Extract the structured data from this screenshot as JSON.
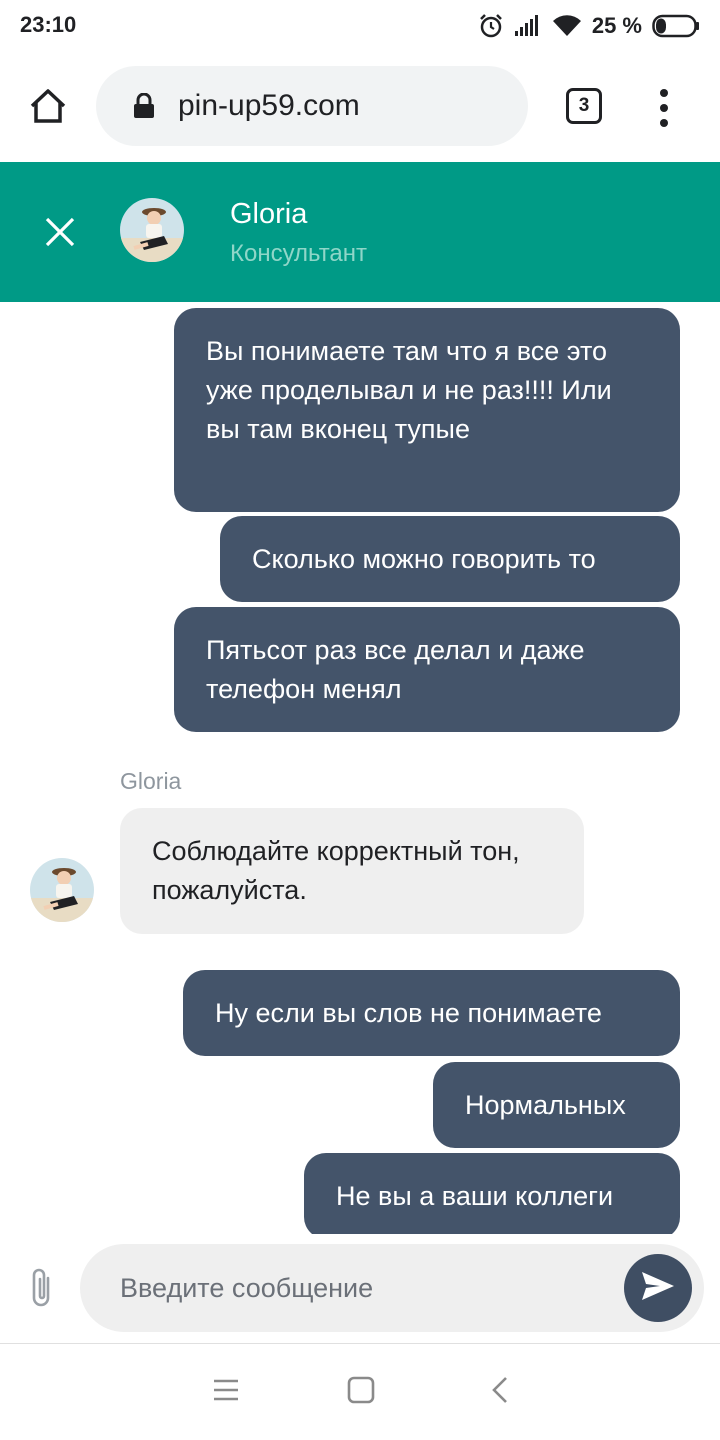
{
  "status_bar": {
    "time": "23:10",
    "battery": "25 %",
    "icons": [
      "alarm-icon",
      "signal-icon",
      "wifi-icon",
      "battery-icon"
    ]
  },
  "browser": {
    "url": "pin-up59.com",
    "tab_count": "3",
    "icons": [
      "home-icon",
      "lock-icon",
      "tabs-icon",
      "more-menu-icon"
    ]
  },
  "chat_header": {
    "agent_name": "Gloria",
    "agent_role": "Консультант",
    "accent_color": "#009a86"
  },
  "messages": [
    {
      "from": "user",
      "text": "Вы понимаете там что я все это уже проделывал и не раз!!!! Или вы там вконец тупые"
    },
    {
      "from": "user",
      "text": "Сколько можно говорить то"
    },
    {
      "from": "user",
      "text": "Пятьсот раз все делал и даже телефон менял"
    },
    {
      "from": "agent",
      "sender": "Gloria",
      "text": "Соблюдайте корректный тон, пожалуйста."
    },
    {
      "from": "user",
      "text": "Ну если вы слов не понимаете"
    },
    {
      "from": "user",
      "text": "Нормальных"
    },
    {
      "from": "user",
      "text": "Не вы а ваши коллеги"
    }
  ],
  "composer": {
    "placeholder": "Введите сообщение",
    "value": ""
  },
  "colors": {
    "user_bubble": "#44546a",
    "agent_bubble": "#efefef",
    "send_button": "#3f4e63"
  }
}
